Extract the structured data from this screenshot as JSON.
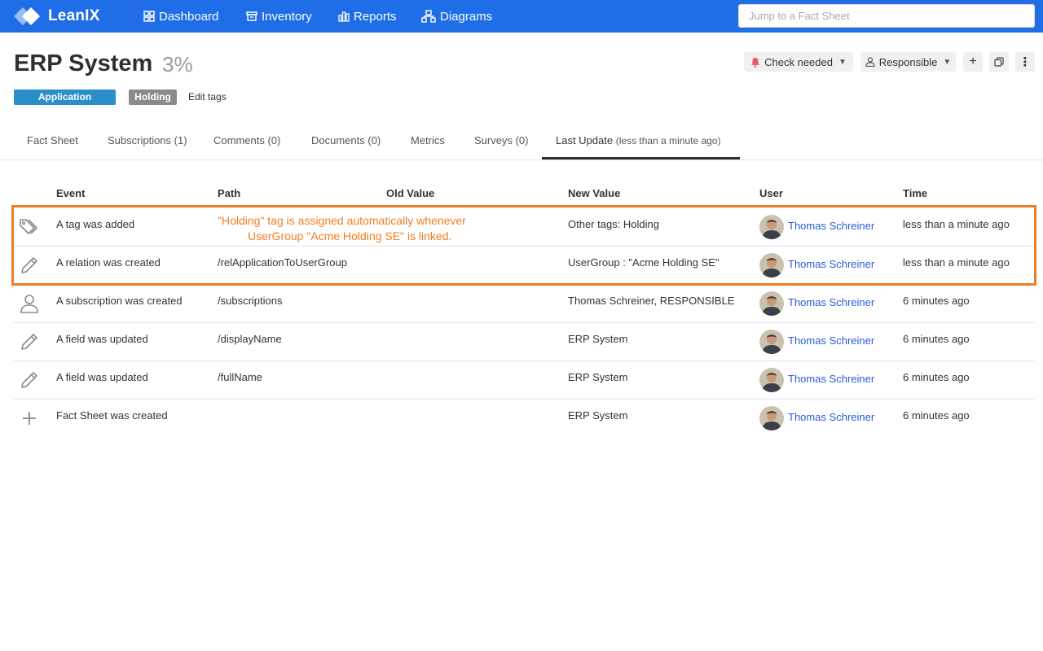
{
  "nav": {
    "brand": "LeanIX",
    "items": [
      {
        "label": "Dashboard",
        "icon": "grid-icon"
      },
      {
        "label": "Inventory",
        "icon": "inventory-icon"
      },
      {
        "label": "Reports",
        "icon": "bar-chart-icon"
      },
      {
        "label": "Diagrams",
        "icon": "diagram-icon"
      }
    ],
    "search_placeholder": "Jump to a Fact Sheet"
  },
  "factsheet": {
    "title": "ERP System",
    "completion": "3%",
    "type_tag": "Application",
    "tags": [
      "Holding"
    ],
    "edit_tags_label": "Edit tags"
  },
  "actions": {
    "check_needed": "Check needed",
    "responsible": "Responsible",
    "add": "+",
    "copy": "copy-icon",
    "more": "⋮"
  },
  "tabs": [
    {
      "label": "Fact Sheet",
      "sub": ""
    },
    {
      "label": "Subscriptions (1)",
      "sub": ""
    },
    {
      "label": "Comments (0)",
      "sub": ""
    },
    {
      "label": "Documents (0)",
      "sub": ""
    },
    {
      "label": "Metrics",
      "sub": ""
    },
    {
      "label": "Surveys (0)",
      "sub": ""
    },
    {
      "label": "Last Update",
      "sub": "(less than a minute ago)"
    }
  ],
  "table": {
    "headers": {
      "event": "Event",
      "path": "Path",
      "old": "Old Value",
      "new": "New Value",
      "user": "User",
      "time": "Time"
    },
    "rows": [
      {
        "icon": "tag-icon",
        "event": "A tag was added",
        "path": "",
        "old": "",
        "new": "Other tags: Holding",
        "user": "Thomas Schreiner",
        "time": "less than a minute ago"
      },
      {
        "icon": "pencil-icon",
        "event": "A relation was created",
        "path": "/relApplicationToUserGroup",
        "old": "",
        "new": "UserGroup : \"Acme Holding SE\"",
        "user": "Thomas Schreiner",
        "time": "less than a minute ago"
      },
      {
        "icon": "person-icon",
        "event": "A subscription was created",
        "path": "/subscriptions",
        "old": "",
        "new": "Thomas Schreiner, RESPONSIBLE",
        "user": "Thomas Schreiner",
        "time": "6 minutes ago"
      },
      {
        "icon": "pencil-icon",
        "event": "A field was updated",
        "path": "/displayName",
        "old": "",
        "new": "ERP System",
        "user": "Thomas Schreiner",
        "time": "6 minutes ago"
      },
      {
        "icon": "pencil-icon",
        "event": "A field was updated",
        "path": "/fullName",
        "old": "",
        "new": "ERP System",
        "user": "Thomas Schreiner",
        "time": "6 minutes ago"
      },
      {
        "icon": "plus-icon",
        "event": "Fact Sheet was created",
        "path": "",
        "old": "",
        "new": "ERP System",
        "user": "Thomas Schreiner",
        "time": "6 minutes ago"
      }
    ]
  },
  "annotation": {
    "line1": "\"Holding\" tag is assigned automatically whenever",
    "line2": "UserGroup \"Acme Holding SE\" is linked.",
    "color": "#f07d23"
  },
  "colors": {
    "topbar": "#1f6ee8",
    "app_tag": "#2a8ecb",
    "holding_tag": "#8a8a8a",
    "link": "#2a5cd6"
  }
}
